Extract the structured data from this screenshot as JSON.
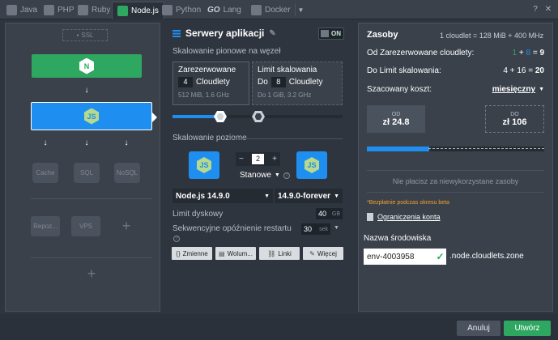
{
  "tabs": [
    {
      "label": "Java",
      "icon": "java-icon"
    },
    {
      "label": "PHP",
      "icon": "php-icon"
    },
    {
      "label": "Ruby",
      "icon": "ruby-icon"
    },
    {
      "label": "Node.js",
      "icon": "nodejs-icon",
      "active": true
    },
    {
      "label": "Python",
      "icon": "python-icon"
    },
    {
      "label": "Lang",
      "icon": "go-icon",
      "prefix": "GO"
    },
    {
      "label": "Docker",
      "icon": "docker-icon"
    }
  ],
  "topology": {
    "ssl": "SSL",
    "db": [
      "Cache",
      "SQL",
      "NoSQL"
    ],
    "storage": [
      "Repoz...",
      "VPS"
    ]
  },
  "main": {
    "title": "Serwery aplikacji",
    "toggle": "ON",
    "vertical_label": "Skalowanie pionowe na węzeł",
    "reserved": {
      "title": "Zarezerwowane",
      "value": "4",
      "unit": "Cloudlety",
      "sub": "512 MiB, 1.6 GHz"
    },
    "limit": {
      "title": "Limit skalowania",
      "prefix": "Do",
      "value": "8",
      "unit": "Cloudlety",
      "sub": "Do 1 GiB, 3.2 GHz"
    },
    "horizontal_label": "Skalowanie poziome",
    "nodes_count": "2",
    "nodes_mode": "Stanowe",
    "engine": "Node.js 14.9.0",
    "version": "14.9.0-forever",
    "disk_label": "Limit dyskowy",
    "disk_value": "40",
    "disk_unit": "GB",
    "restart_label": "Sekwencyjne opóźnienie restartu",
    "restart_value": "30",
    "restart_unit": "sek",
    "buttons": [
      "Zmienne",
      "Wolum...",
      "Linki",
      "Więcej"
    ]
  },
  "resources": {
    "title": "Zasoby",
    "formula": "1 cloudlet = 128 MiB + 400 MHz",
    "reserved_label_prefix": "Od",
    "reserved_label_bold": "Zarezerwowane cloudlety",
    "reserved_a": "1",
    "reserved_b": "8",
    "reserved_total": "9",
    "limit_label_prefix": "Do",
    "limit_label_bold": "Limit skalowania",
    "limit_a": "4",
    "limit_b": "16",
    "limit_total": "20",
    "cost_label": "Szacowany koszt:",
    "cost_period": "miesięczny",
    "from_label": "OD",
    "from_value": "zł 24.8",
    "to_label": "DO",
    "to_value": "zł 106",
    "cost_bar_fraction": 0.35,
    "notice": "Nie płacisz za niewykorzystane zasoby",
    "free_note": "*Bezpłatnie podczas okresu beta",
    "limits_link": "Ograniczenia konta",
    "env_label": "Nazwa środowiska",
    "env_value": "env-4003958",
    "env_domain": ".node.cloudlets.zone"
  },
  "footer": {
    "cancel": "Anuluj",
    "create": "Utwórz"
  },
  "colors": {
    "accent": "#1f8ef1",
    "green": "#2ea861",
    "orange": "#f0a030"
  }
}
